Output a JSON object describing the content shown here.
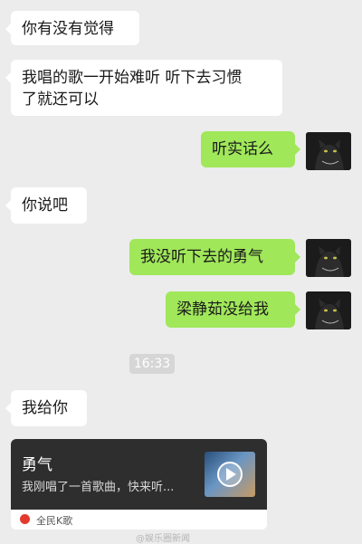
{
  "messages": [
    {
      "side": "in",
      "text": "你有没有觉得"
    },
    {
      "side": "in",
      "lines": [
        "我唱的歌一开始难听 听下去习惯",
        "了就还可以"
      ]
    },
    {
      "side": "out",
      "text": "听实话么"
    },
    {
      "side": "in",
      "text": "你说吧"
    },
    {
      "side": "out",
      "text": "我没听下去的勇气"
    },
    {
      "side": "out",
      "text": "梁静茹没给我"
    },
    {
      "side": "in",
      "text": "我给你"
    }
  ],
  "timestamp": "16:33",
  "share_card": {
    "title": "勇气",
    "description": "我刚唱了一首歌曲，快来听...",
    "source": "全民K歌",
    "play_icon": "play-icon",
    "source_icon": "kge-logo-icon"
  },
  "watermark": "@娱乐圈新闻",
  "colors": {
    "background": "#ececec",
    "incoming_bubble": "#ffffff",
    "outgoing_bubble": "#a0e75a",
    "card_dark": "#2e2e2e"
  }
}
